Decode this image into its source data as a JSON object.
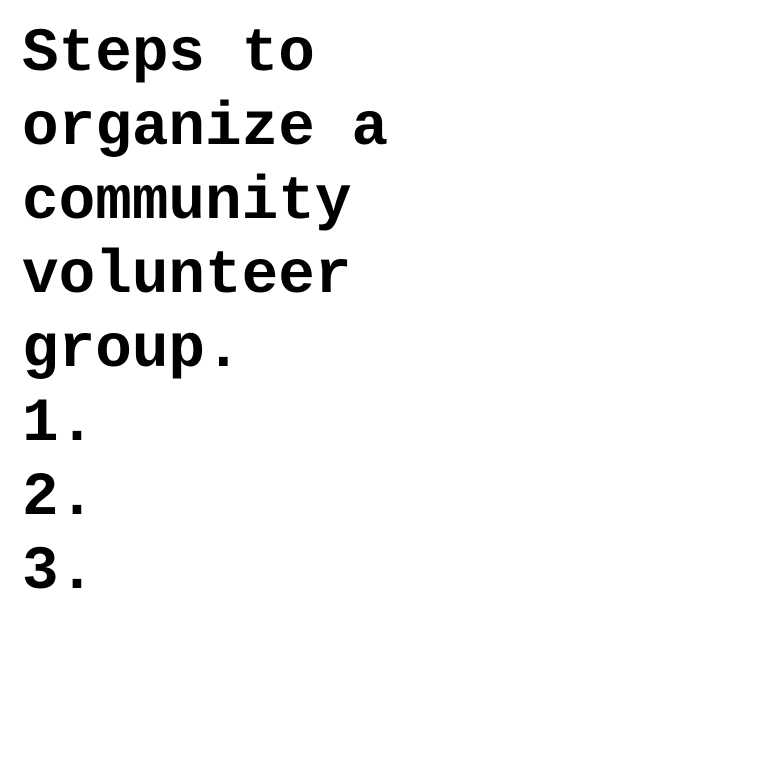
{
  "document": {
    "title_lines": [
      "Steps to",
      "organize a",
      "community",
      "volunteer",
      "group."
    ],
    "list_items": [
      "1.",
      "2.",
      "3."
    ]
  },
  "colors": {
    "text": "#000000",
    "background": "#ffffff"
  }
}
